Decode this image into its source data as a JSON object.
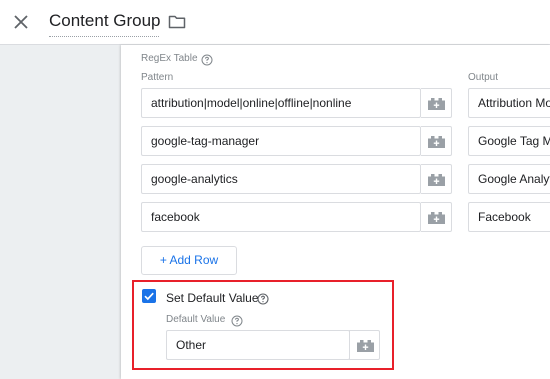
{
  "header": {
    "title": "Content Group"
  },
  "regex_table": {
    "label": "RegEx Table",
    "pattern_header": "Pattern",
    "output_header": "Output",
    "rows": [
      {
        "pattern": "attribution|model|online|offline|nonline",
        "output": "Attribution Mo"
      },
      {
        "pattern": "google-tag-manager",
        "output": "Google Tag Ma"
      },
      {
        "pattern": "google-analytics",
        "output": "Google Analyti"
      },
      {
        "pattern": "facebook",
        "output": "Facebook"
      }
    ],
    "add_row_label": "+ Add Row"
  },
  "default_value": {
    "checkbox_label": "Set Default Value",
    "checked": true,
    "field_label": "Default Value",
    "value": "Other"
  },
  "colors": {
    "accent": "#1a73e8",
    "highlight": "#e8202a"
  }
}
